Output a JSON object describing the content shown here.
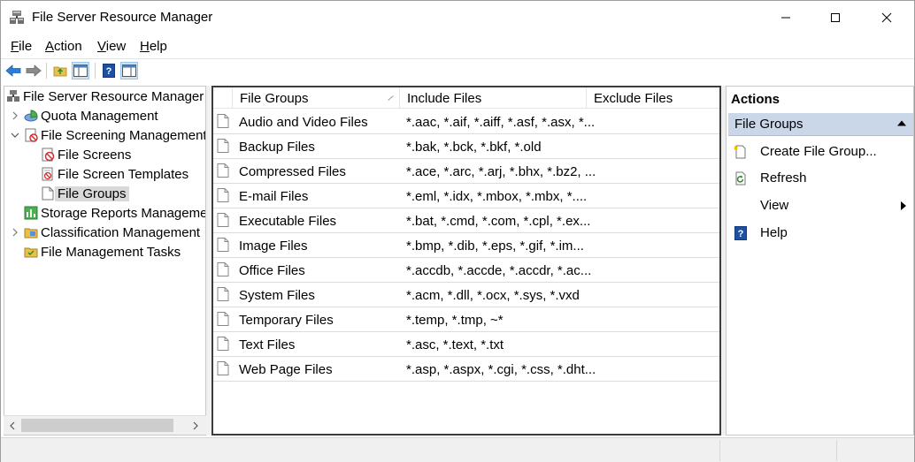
{
  "window": {
    "title": "File Server Resource Manager"
  },
  "menu": [
    {
      "label": "File",
      "accel": "F",
      "rest": "ile"
    },
    {
      "label": "Action",
      "accel": "A",
      "rest": "ction"
    },
    {
      "label": "View",
      "accel": "V",
      "rest": "iew"
    },
    {
      "label": "Help",
      "accel": "H",
      "rest": "elp"
    }
  ],
  "tree": {
    "root": "File Server Resource Manager (",
    "items": [
      {
        "label": "Quota Management",
        "icon": "quota-icon"
      },
      {
        "label": "File Screening Management",
        "icon": "screening-icon"
      },
      {
        "label": "File Screens",
        "icon": "file-screen-icon"
      },
      {
        "label": "File Screen Templates",
        "icon": "file-screen-template-icon"
      },
      {
        "label": "File Groups",
        "icon": "file-group-icon",
        "selected": true
      },
      {
        "label": "Storage Reports Manageme",
        "icon": "storage-reports-icon"
      },
      {
        "label": "Classification Management",
        "icon": "classification-icon"
      },
      {
        "label": "File Management Tasks",
        "icon": "file-tasks-icon"
      }
    ]
  },
  "list": {
    "columns": [
      "File Groups",
      "Include Files",
      "Exclude Files"
    ],
    "rows": [
      {
        "name": "Audio and Video Files",
        "include": "*.aac, *.aif, *.aiff, *.asf, *.asx, *...",
        "exclude": ""
      },
      {
        "name": "Backup Files",
        "include": "*.bak, *.bck, *.bkf, *.old",
        "exclude": ""
      },
      {
        "name": "Compressed Files",
        "include": "*.ace, *.arc, *.arj, *.bhx, *.bz2, ...",
        "exclude": ""
      },
      {
        "name": "E-mail Files",
        "include": "*.eml, *.idx, *.mbox, *.mbx, *....",
        "exclude": ""
      },
      {
        "name": "Executable Files",
        "include": "*.bat, *.cmd, *.com, *.cpl, *.ex...",
        "exclude": ""
      },
      {
        "name": "Image Files",
        "include": "*.bmp, *.dib, *.eps, *.gif, *.im...",
        "exclude": ""
      },
      {
        "name": "Office Files",
        "include": "*.accdb, *.accde, *.accdr, *.ac...",
        "exclude": ""
      },
      {
        "name": "System Files",
        "include": "*.acm, *.dll, *.ocx, *.sys, *.vxd",
        "exclude": ""
      },
      {
        "name": "Temporary Files",
        "include": "*.temp, *.tmp, ~*",
        "exclude": ""
      },
      {
        "name": "Text Files",
        "include": "*.asc, *.text, *.txt",
        "exclude": ""
      },
      {
        "name": "Web Page Files",
        "include": "*.asp, *.aspx, *.cgi, *.css, *.dht...",
        "exclude": ""
      }
    ]
  },
  "actions": {
    "title": "Actions",
    "section": "File Groups",
    "items": [
      {
        "label": "Create File Group...",
        "icon": "create-file-group-icon"
      },
      {
        "label": "Refresh",
        "icon": "refresh-icon"
      },
      {
        "label": "View",
        "icon": "",
        "submenu": true
      },
      {
        "label": "Help",
        "icon": "help-icon"
      }
    ]
  },
  "colors": {
    "selection": "#d9d9d9",
    "actions_header": "#c9d7e8",
    "accent_blue": "#1a5fb4"
  }
}
